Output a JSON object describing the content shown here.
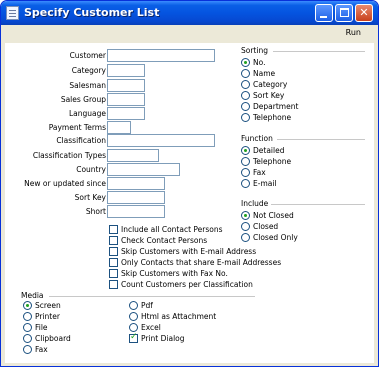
{
  "window": {
    "title": "Specify Customer List",
    "run_label": "Run"
  },
  "fields": [
    {
      "label": "Customer",
      "value": ""
    },
    {
      "label": "Category",
      "value": ""
    },
    {
      "label": "Salesman",
      "value": ""
    },
    {
      "label": "Sales Group",
      "value": ""
    },
    {
      "label": "Language",
      "value": ""
    },
    {
      "label": "Payment Terms",
      "value": ""
    },
    {
      "label": "Classification",
      "value": ""
    },
    {
      "label": "Classification Types",
      "value": ""
    },
    {
      "label": "Country",
      "value": ""
    },
    {
      "label": "New or updated since",
      "value": ""
    },
    {
      "label": "Sort Key",
      "value": ""
    },
    {
      "label": "Short",
      "value": ""
    }
  ],
  "checkboxes": [
    {
      "label": "Include all Contact Persons",
      "checked": false
    },
    {
      "label": "Check Contact Persons",
      "checked": false
    },
    {
      "label": "Skip Customers with E-mail Address",
      "checked": false
    },
    {
      "label": "Only Contacts that share E-mail Addresses",
      "checked": false
    },
    {
      "label": "Skip Customers with Fax No.",
      "checked": false
    },
    {
      "label": "Count Customers per Classification",
      "checked": false
    }
  ],
  "sorting": {
    "title": "Sorting",
    "options": [
      "No.",
      "Name",
      "Category",
      "Sort Key",
      "Department",
      "Telephone"
    ],
    "selected": "No."
  },
  "function": {
    "title": "Function",
    "options": [
      "Detailed",
      "Telephone",
      "Fax",
      "E-mail"
    ],
    "selected": "Detailed"
  },
  "include": {
    "title": "Include",
    "options": [
      "Not Closed",
      "Closed",
      "Closed Only"
    ],
    "selected": "Not Closed"
  },
  "media": {
    "title": "Media",
    "options_left": [
      "Screen",
      "Printer",
      "File",
      "Clipboard",
      "Fax"
    ],
    "options_right": [
      "Pdf",
      "Html as Attachment",
      "Excel"
    ],
    "selected": "Screen",
    "print_dialog_label": "Print Dialog",
    "print_dialog_checked": true
  }
}
